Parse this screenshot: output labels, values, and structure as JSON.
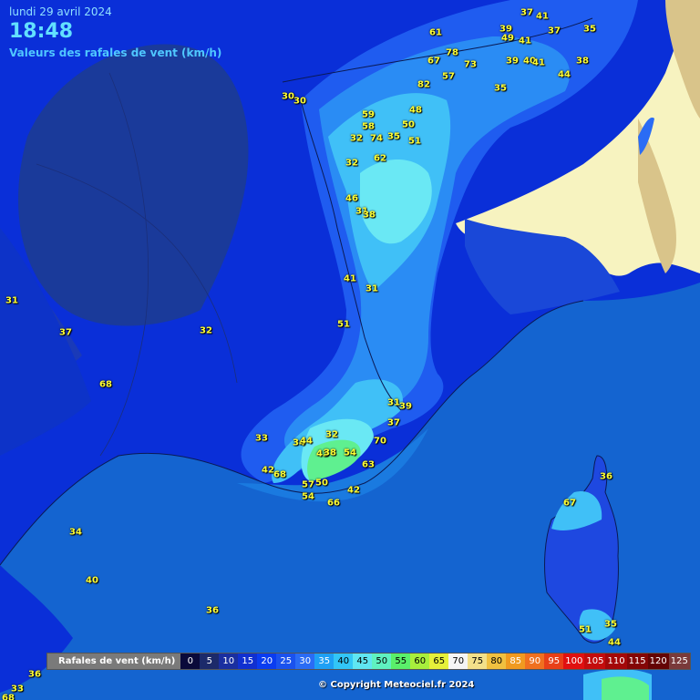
{
  "header": {
    "date": "lundi 29 avril 2024",
    "time": "18:48",
    "subtitle": "Valeurs des rafales de vent (km/h)"
  },
  "legend": {
    "title": "Rafales de vent (km/h)",
    "steps": [
      {
        "label": "0",
        "color": "#0a0a3a",
        "text": "#fff"
      },
      {
        "label": "5",
        "color": "#1c2a6a",
        "text": "#fff"
      },
      {
        "label": "10",
        "color": "#1a2fa0",
        "text": "#fff"
      },
      {
        "label": "15",
        "color": "#1030d0",
        "text": "#fff"
      },
      {
        "label": "20",
        "color": "#0a3cf0",
        "text": "#fff"
      },
      {
        "label": "25",
        "color": "#1a52ee",
        "text": "#fff"
      },
      {
        "label": "30",
        "color": "#2a6cf5",
        "text": "#fff"
      },
      {
        "label": "35",
        "color": "#1ea0f5",
        "text": "#fff"
      },
      {
        "label": "40",
        "color": "#32c6f7",
        "text": "#000"
      },
      {
        "label": "45",
        "color": "#5fe6f2",
        "text": "#000"
      },
      {
        "label": "50",
        "color": "#5ff2c0",
        "text": "#000"
      },
      {
        "label": "55",
        "color": "#5af06a",
        "text": "#000"
      },
      {
        "label": "60",
        "color": "#a8ee3c",
        "text": "#000"
      },
      {
        "label": "65",
        "color": "#e6f03a",
        "text": "#000"
      },
      {
        "label": "70",
        "color": "#f5f5f5",
        "text": "#000"
      },
      {
        "label": "75",
        "color": "#f2e08a",
        "text": "#000"
      },
      {
        "label": "80",
        "color": "#f0c040",
        "text": "#000"
      },
      {
        "label": "85",
        "color": "#f09a20",
        "text": "#fff"
      },
      {
        "label": "90",
        "color": "#f07020",
        "text": "#fff"
      },
      {
        "label": "95",
        "color": "#e84018",
        "text": "#fff"
      },
      {
        "label": "100",
        "color": "#e01010",
        "text": "#fff"
      },
      {
        "label": "105",
        "color": "#c40c0c",
        "text": "#fff"
      },
      {
        "label": "110",
        "color": "#a40808",
        "text": "#fff"
      },
      {
        "label": "115",
        "color": "#840606",
        "text": "#fff"
      },
      {
        "label": "120",
        "color": "#640404",
        "text": "#fff"
      },
      {
        "label": "125",
        "color": "#7a3a3a",
        "text": "#fff"
      }
    ]
  },
  "copyright": "© Copyright Meteociel.fr 2024",
  "stations": [
    {
      "v": "37"
    },
    {
      "v": "41"
    },
    {
      "v": "39"
    },
    {
      "v": "49"
    },
    {
      "v": "41"
    },
    {
      "v": "37"
    },
    {
      "v": "35"
    },
    {
      "v": "61"
    },
    {
      "v": "67"
    },
    {
      "v": "78"
    },
    {
      "v": "73"
    },
    {
      "v": "57"
    },
    {
      "v": "39"
    },
    {
      "v": "40"
    },
    {
      "v": "41"
    },
    {
      "v": "38"
    },
    {
      "v": "44"
    },
    {
      "v": "82"
    },
    {
      "v": "35"
    },
    {
      "v": "30"
    },
    {
      "v": "30"
    },
    {
      "v": "59"
    },
    {
      "v": "58"
    },
    {
      "v": "48"
    },
    {
      "v": "50"
    },
    {
      "v": "32"
    },
    {
      "v": "74"
    },
    {
      "v": "35"
    },
    {
      "v": "51"
    },
    {
      "v": "62"
    },
    {
      "v": "32"
    },
    {
      "v": "46"
    },
    {
      "v": "31"
    },
    {
      "v": "38"
    },
    {
      "v": "41"
    },
    {
      "v": "31"
    },
    {
      "v": "31"
    },
    {
      "v": "51"
    },
    {
      "v": "37"
    },
    {
      "v": "32"
    },
    {
      "v": "68"
    },
    {
      "v": "31"
    },
    {
      "v": "39"
    },
    {
      "v": "37"
    },
    {
      "v": "32"
    },
    {
      "v": "33"
    },
    {
      "v": "34"
    },
    {
      "v": "44"
    },
    {
      "v": "70"
    },
    {
      "v": "43"
    },
    {
      "v": "38"
    },
    {
      "v": "54"
    },
    {
      "v": "63"
    },
    {
      "v": "42"
    },
    {
      "v": "68"
    },
    {
      "v": "57"
    },
    {
      "v": "50"
    },
    {
      "v": "42"
    },
    {
      "v": "54"
    },
    {
      "v": "66"
    },
    {
      "v": "36"
    },
    {
      "v": "67"
    },
    {
      "v": "34"
    },
    {
      "v": "40"
    },
    {
      "v": "36"
    },
    {
      "v": "51"
    },
    {
      "v": "35"
    },
    {
      "v": "44"
    },
    {
      "v": "36"
    },
    {
      "v": "33"
    },
    {
      "v": "68"
    }
  ]
}
